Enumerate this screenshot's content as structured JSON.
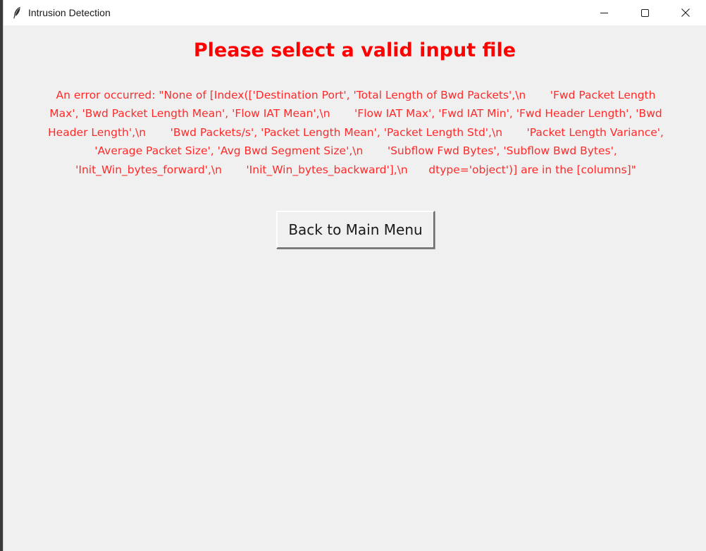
{
  "window": {
    "title": "Intrusion Detection",
    "icon": "feather-icon",
    "controls": [
      "minimize-icon",
      "maximize-icon",
      "close-icon"
    ]
  },
  "main": {
    "heading": "Please select a valid input file",
    "error_message": "An error occurred: \"None of [Index(['Destination Port', 'Total Length of Bwd Packets',\\n       'Fwd Packet Length Max', 'Bwd Packet Length Mean', 'Flow IAT Mean',\\n       'Flow IAT Max', 'Fwd IAT Min', 'Fwd Header Length', 'Bwd Header Length',\\n       'Bwd Packets/s', 'Packet Length Mean', 'Packet Length Std',\\n       'Packet Length Variance', 'Average Packet Size', 'Avg Bwd Segment Size',\\n       'Subflow Fwd Bytes', 'Subflow Bwd Bytes', 'Init_Win_bytes_forward',\\n       'Init_Win_bytes_backward'],\\n      dtype='object')] are in the [columns]\"",
    "back_button_label": "Back to Main Menu"
  },
  "colors": {
    "heading": "#ff0000",
    "error_text": "#ff2a2a",
    "window_bg": "#f0f0f0",
    "titlebar_bg": "#ffffff"
  }
}
